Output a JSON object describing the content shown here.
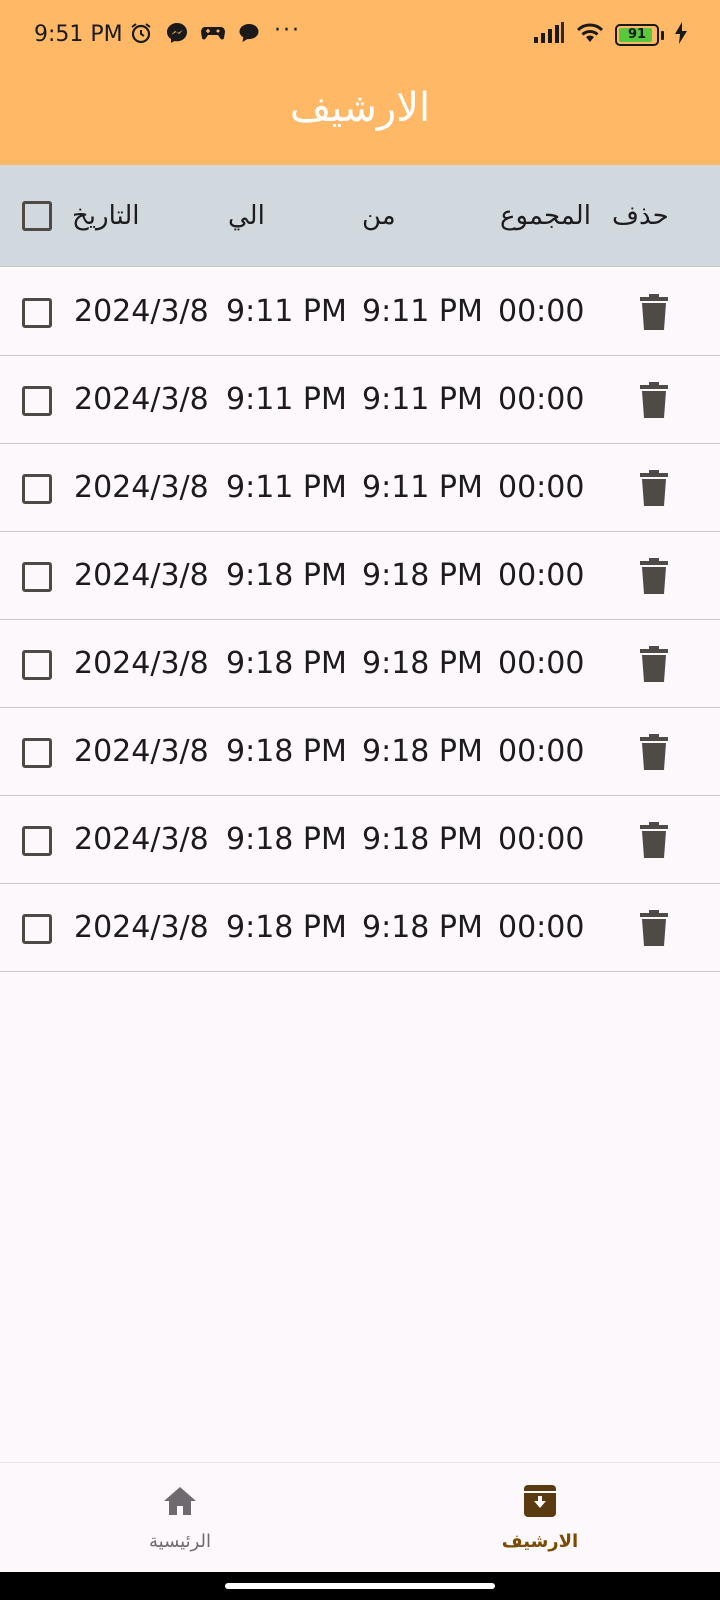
{
  "status_bar": {
    "time": "9:51 PM",
    "left_icons": [
      "alarm-icon",
      "messenger-icon",
      "game-icon",
      "chat-bubble-icon"
    ],
    "overflow": "···",
    "battery_level": "91",
    "charging": true
  },
  "app_bar": {
    "title": "الارشيف"
  },
  "table_header": {
    "select_all_checked": false,
    "col_date": "التاريخ",
    "col_to": "الي",
    "col_from": "من",
    "col_total": "المجموع",
    "col_delete": "حذف"
  },
  "rows": [
    {
      "checked": false,
      "date": "2024/3/8",
      "to": "9:11 PM",
      "from": "9:11 PM",
      "total": "00:00"
    },
    {
      "checked": false,
      "date": "2024/3/8",
      "to": "9:11 PM",
      "from": "9:11 PM",
      "total": "00:00"
    },
    {
      "checked": false,
      "date": "2024/3/8",
      "to": "9:11 PM",
      "from": "9:11 PM",
      "total": "00:00"
    },
    {
      "checked": false,
      "date": "2024/3/8",
      "to": "9:18 PM",
      "from": "9:18 PM",
      "total": "00:00"
    },
    {
      "checked": false,
      "date": "2024/3/8",
      "to": "9:18 PM",
      "from": "9:18 PM",
      "total": "00:00"
    },
    {
      "checked": false,
      "date": "2024/3/8",
      "to": "9:18 PM",
      "from": "9:18 PM",
      "total": "00:00"
    },
    {
      "checked": false,
      "date": "2024/3/8",
      "to": "9:18 PM",
      "from": "9:18 PM",
      "total": "00:00"
    },
    {
      "checked": false,
      "date": "2024/3/8",
      "to": "9:18 PM",
      "from": "9:18 PM",
      "total": "00:00"
    }
  ],
  "bottom_nav": {
    "home_label": "الرئيسية",
    "archive_label": "الارشيف",
    "active": "archive"
  },
  "colors": {
    "app_bar": "#ffb866",
    "header_bg": "#d1d9de",
    "icon_dark": "#4f4a45",
    "active_nav": "#7a4a00",
    "inactive_nav": "#6e6a70"
  }
}
